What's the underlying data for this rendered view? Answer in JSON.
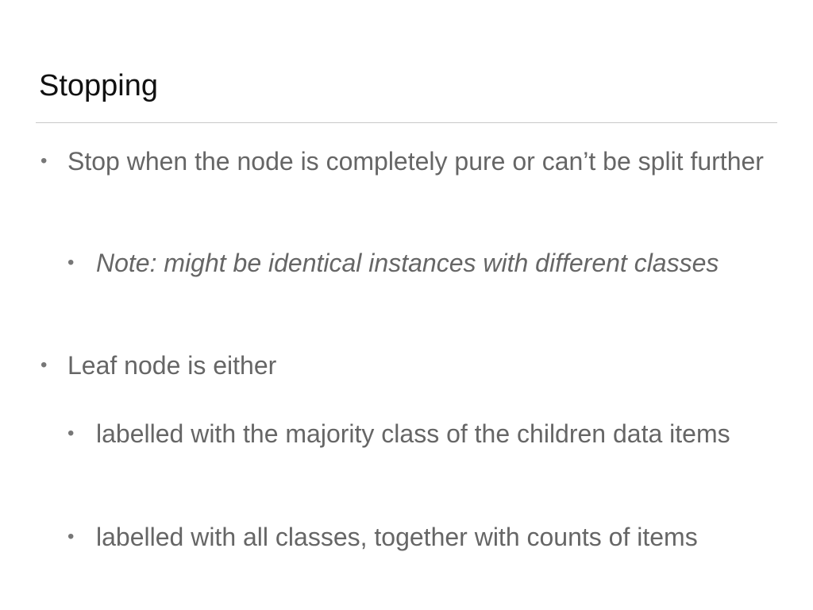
{
  "slide": {
    "title": "Stopping",
    "bullets": [
      {
        "level": 1,
        "marker": "•",
        "text": "Stop when the node is completely pure or can’t be split further"
      },
      {
        "level": 2,
        "marker": "•",
        "text": "Note: might be identical instances with different classes"
      },
      {
        "level": 1,
        "marker": "•",
        "text": "Leaf node is either"
      },
      {
        "level": 2,
        "marker": "•",
        "text": "labelled with the majority class of the children data items"
      },
      {
        "level": 2,
        "marker": "•",
        "text": "labelled with all classes, together with counts of items"
      }
    ]
  }
}
